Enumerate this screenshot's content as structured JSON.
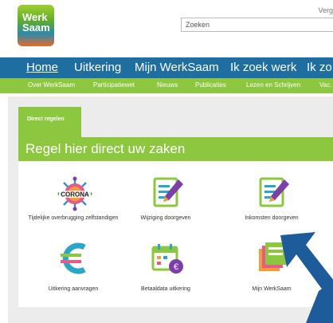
{
  "header": {
    "logo_line1": "Werk",
    "logo_line2": "Saam",
    "top_right_text": "Verg",
    "search_placeholder": "Zoeken"
  },
  "nav_main": [
    "Home",
    "Uitkering",
    "Mijn WerkSaam",
    "Ik zoek werk",
    "Ik zo"
  ],
  "nav_sub": [
    "Over WerkSaam",
    "Participatiewet",
    "Nieuws",
    "Publicaties",
    "Lezen en Schrijven",
    "Vac."
  ],
  "tab_label": "Direct regelen",
  "panel_title": "Regel hier direct uw zaken",
  "tiles": [
    {
      "label": "Tijdelijke overbrugging zelfstandigen",
      "icon": "corona-virus-icon",
      "icon_text": "CORONA"
    },
    {
      "label": "Wijziging doorgeven",
      "icon": "document-pencil-icon"
    },
    {
      "label": "Inkomsten doorgeven",
      "icon": "document-pencil-icon"
    },
    {
      "label": "Uitkering aanvragen",
      "icon": "euro-icon"
    },
    {
      "label": "Betaaldata uitkering",
      "icon": "calendar-euro-icon"
    },
    {
      "label": "Mijn WerkSaam",
      "icon": "documents-icon"
    }
  ],
  "colors": {
    "primary": "#1f6ea1",
    "accent": "#8dc63f",
    "arrow": "#1d5b9b"
  }
}
